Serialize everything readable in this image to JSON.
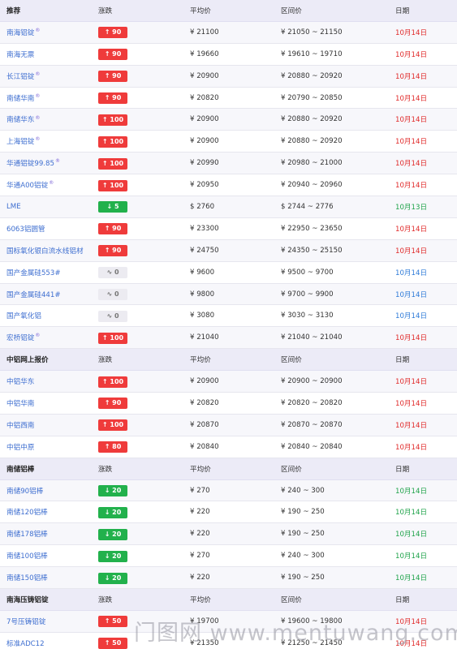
{
  "sections": [
    {
      "header": {
        "name": "推荐",
        "change": "涨跌",
        "avg": "平均价",
        "range": "区间价",
        "date": "日期"
      },
      "rows": [
        {
          "name": "南海铝锭",
          "mark": "®",
          "change": "↑ 90",
          "dir": "up",
          "avg": "¥ 21100",
          "range": "¥ 21050 ~ 21150",
          "date": "10月14日",
          "date_color": "red"
        },
        {
          "name": "南海无票",
          "mark": "",
          "change": "↑ 90",
          "dir": "up",
          "avg": "¥ 19660",
          "range": "¥ 19610 ~ 19710",
          "date": "10月14日",
          "date_color": "red"
        },
        {
          "name": "长江铝锭",
          "mark": "®",
          "change": "↑ 90",
          "dir": "up",
          "avg": "¥ 20900",
          "range": "¥ 20880 ~ 20920",
          "date": "10月14日",
          "date_color": "red"
        },
        {
          "name": "南储华南",
          "mark": "®",
          "change": "↑ 90",
          "dir": "up",
          "avg": "¥ 20820",
          "range": "¥ 20790 ~ 20850",
          "date": "10月14日",
          "date_color": "red"
        },
        {
          "name": "南储华东",
          "mark": "®",
          "change": "↑ 100",
          "dir": "up",
          "avg": "¥ 20900",
          "range": "¥ 20880 ~ 20920",
          "date": "10月14日",
          "date_color": "red"
        },
        {
          "name": "上海铝锭",
          "mark": "®",
          "change": "↑ 100",
          "dir": "up",
          "avg": "¥ 20900",
          "range": "¥ 20880 ~ 20920",
          "date": "10月14日",
          "date_color": "red"
        },
        {
          "name": "华通铝锭99.85",
          "mark": "®",
          "change": "↑ 100",
          "dir": "up",
          "avg": "¥ 20990",
          "range": "¥ 20980 ~ 21000",
          "date": "10月14日",
          "date_color": "red"
        },
        {
          "name": "华通A00铝锭",
          "mark": "®",
          "change": "↑ 100",
          "dir": "up",
          "avg": "¥ 20950",
          "range": "¥ 20940 ~ 20960",
          "date": "10月14日",
          "date_color": "red"
        },
        {
          "name": "LME",
          "mark": "",
          "change": "↓ 5",
          "dir": "down",
          "avg": "$ 2760",
          "range": "$ 2744 ~ 2776",
          "date": "10月13日",
          "date_color": "green"
        },
        {
          "name": "6063铝圆管",
          "mark": "",
          "change": "↑ 90",
          "dir": "up",
          "avg": "¥ 23300",
          "range": "¥ 22950 ~ 23650",
          "date": "10月14日",
          "date_color": "red"
        },
        {
          "name": "国标氧化银白流水线铝材",
          "mark": "",
          "change": "↑ 90",
          "dir": "up",
          "avg": "¥ 24750",
          "range": "¥ 24350 ~ 25150",
          "date": "10月14日",
          "date_color": "red"
        },
        {
          "name": "国产金属硅553#",
          "mark": "",
          "change": "∿ 0",
          "dir": "flat",
          "avg": "¥ 9600",
          "range": "¥ 9500 ~ 9700",
          "date": "10月14日",
          "date_color": "blue"
        },
        {
          "name": "国产金属硅441#",
          "mark": "",
          "change": "∿ 0",
          "dir": "flat",
          "avg": "¥ 9800",
          "range": "¥ 9700 ~ 9900",
          "date": "10月14日",
          "date_color": "blue"
        },
        {
          "name": "国产氧化铝",
          "mark": "",
          "change": "∿ 0",
          "dir": "flat",
          "avg": "¥ 3080",
          "range": "¥ 3030 ~ 3130",
          "date": "10月14日",
          "date_color": "blue"
        },
        {
          "name": "宏桥铝锭",
          "mark": "®",
          "change": "↑ 100",
          "dir": "up",
          "avg": "¥ 21040",
          "range": "¥ 21040 ~ 21040",
          "date": "10月14日",
          "date_color": "red"
        }
      ]
    },
    {
      "header": {
        "name": "中铝网上报价",
        "change": "涨跌",
        "avg": "平均价",
        "range": "区间价",
        "date": "日期"
      },
      "rows": [
        {
          "name": "中铝华东",
          "mark": "",
          "change": "↑ 100",
          "dir": "up",
          "avg": "¥ 20900",
          "range": "¥ 20900 ~ 20900",
          "date": "10月14日",
          "date_color": "red"
        },
        {
          "name": "中铝华南",
          "mark": "",
          "change": "↑ 90",
          "dir": "up",
          "avg": "¥ 20820",
          "range": "¥ 20820 ~ 20820",
          "date": "10月14日",
          "date_color": "red"
        },
        {
          "name": "中铝西南",
          "mark": "",
          "change": "↑ 100",
          "dir": "up",
          "avg": "¥ 20870",
          "range": "¥ 20870 ~ 20870",
          "date": "10月14日",
          "date_color": "red"
        },
        {
          "name": "中铝中原",
          "mark": "",
          "change": "↑ 80",
          "dir": "up",
          "avg": "¥ 20840",
          "range": "¥ 20840 ~ 20840",
          "date": "10月14日",
          "date_color": "red"
        }
      ]
    },
    {
      "header": {
        "name": "南储铝棒",
        "change": "涨跌",
        "avg": "平均价",
        "range": "区间价",
        "date": "日期"
      },
      "rows": [
        {
          "name": "南储90铝棒",
          "mark": "",
          "change": "↓ 20",
          "dir": "down",
          "avg": "¥ 270",
          "range": "¥ 240 ~ 300",
          "date": "10月14日",
          "date_color": "green"
        },
        {
          "name": "南储120铝棒",
          "mark": "",
          "change": "↓ 20",
          "dir": "down",
          "avg": "¥ 220",
          "range": "¥ 190 ~ 250",
          "date": "10月14日",
          "date_color": "green"
        },
        {
          "name": "南储178铝棒",
          "mark": "",
          "change": "↓ 20",
          "dir": "down",
          "avg": "¥ 220",
          "range": "¥ 190 ~ 250",
          "date": "10月14日",
          "date_color": "green"
        },
        {
          "name": "南储100铝棒",
          "mark": "",
          "change": "↓ 20",
          "dir": "down",
          "avg": "¥ 270",
          "range": "¥ 240 ~ 300",
          "date": "10月14日",
          "date_color": "green"
        },
        {
          "name": "南储150铝棒",
          "mark": "",
          "change": "↓ 20",
          "dir": "down",
          "avg": "¥ 220",
          "range": "¥ 190 ~ 250",
          "date": "10月14日",
          "date_color": "green"
        }
      ]
    },
    {
      "header": {
        "name": "南海压铸铝锭",
        "change": "涨跌",
        "avg": "平均价",
        "range": "区间价",
        "date": "日期"
      },
      "rows": [
        {
          "name": "7号压铸铝锭",
          "mark": "",
          "change": "↑ 50",
          "dir": "up",
          "avg": "¥ 19700",
          "range": "¥ 19600 ~ 19800",
          "date": "10月14日",
          "date_color": "red"
        },
        {
          "name": "标准ADC12",
          "mark": "",
          "change": "↑ 50",
          "dir": "up",
          "avg": "¥ 21350",
          "range": "¥ 21250 ~ 21450",
          "date": "10月14日",
          "date_color": "red"
        }
      ]
    }
  ],
  "watermark": "门图网 www.mentuwang.com"
}
